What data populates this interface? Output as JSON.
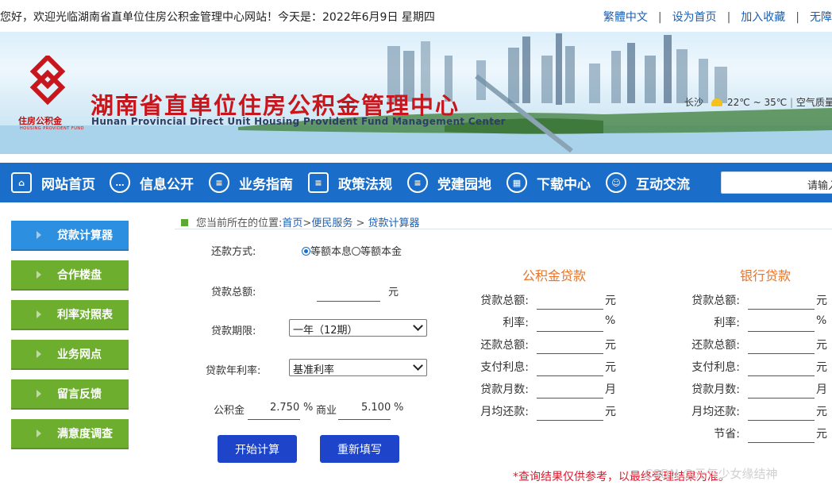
{
  "topbar": {
    "welcome": "您好，欢迎光临湖南省直单位住房公积金管理中心网站！今天是：2022年6月9日    星期四",
    "links": [
      "繁體中文",
      "设为首页",
      "加入收藏",
      "无障"
    ]
  },
  "banner": {
    "logo_cn": "住房公积金",
    "logo_en": "HOUSING PROVIDENT FUND",
    "title_cn": "湖南省直单位住房公积金管理中心",
    "title_en": "Hunan Provincial Direct Unit Housing Provident Fund Management Center",
    "weather_city": "长沙",
    "weather_temp": "22℃ ~ 35℃",
    "weather_air": "空气质量"
  },
  "nav": {
    "items": [
      "网站首页",
      "信息公开",
      "业务指南",
      "政策法规",
      "党建园地",
      "下载中心",
      "互动交流"
    ],
    "search_placeholder": "请输入"
  },
  "sidebar": {
    "items": [
      "贷款计算器",
      "合作楼盘",
      "利率对照表",
      "业务网点",
      "留言反馈",
      "满意度调查"
    ]
  },
  "breadcrumb": {
    "prefix": "您当前所在的位置:",
    "home": "首页",
    "section": "便民服务",
    "page": "贷款计算器"
  },
  "form": {
    "repay_label": "还款方式:",
    "repay_opt1": "等额本息",
    "repay_opt2": "等额本金",
    "total_label": "贷款总额:",
    "total_unit": "元",
    "term_label": "贷款期限:",
    "term_value": "一年（12期）",
    "rate_label": "贷款年利率:",
    "rate_value": "基准利率",
    "gjj_label": "公积金",
    "gjj_rate": "2.750",
    "pct": "%",
    "sy_label": "商业",
    "sy_rate": "5.100",
    "calc_button": "开始计算",
    "reset_button": "重新填写"
  },
  "results": {
    "gjj_title": "公积金贷款",
    "bank_title": "银行贷款",
    "rows": [
      {
        "label": "贷款总额:",
        "unit": "元"
      },
      {
        "label": "利率:",
        "unit": "%"
      },
      {
        "label": "还款总额:",
        "unit": "元"
      },
      {
        "label": "支付利息:",
        "unit": "元"
      },
      {
        "label": "贷款月数:",
        "unit": "月"
      },
      {
        "label": "月均还款:",
        "unit": "元"
      }
    ],
    "save_label": "节省:",
    "save_unit": "元"
  },
  "notice": "*查询结果仅供参考，以最终受理结果为准。",
  "watermark": "CSDN @元气少女缘结神",
  "colors": {
    "nav": "#1a6ec9",
    "sidebar_active": "#2d8fe0",
    "sidebar": "#6eae2f",
    "title_red": "#c8161d",
    "result_orange": "#e8742a",
    "button": "#1d44c9"
  }
}
